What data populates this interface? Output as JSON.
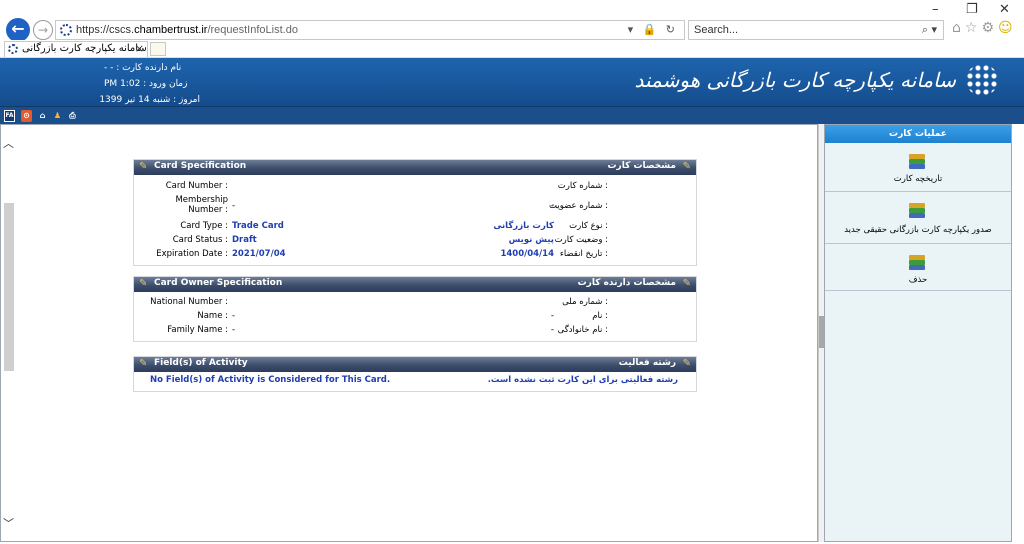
{
  "browser": {
    "url_prefix": "https://cscs.",
    "url_domain": "chambertrust.ir",
    "url_path": "/requestInfoList.do",
    "address_tools": "▾ 🔒 ↻",
    "search_placeholder": "Search...",
    "search_icon": "⌕ ▾",
    "toolbar_icons": [
      "home-icon",
      "star-icon",
      "gear-icon",
      "smiley-icon"
    ],
    "tab_title": "... سامانه یکپارچه کارت بازرگانی",
    "tab_close": "×"
  },
  "header": {
    "holder_name": "نام دارنده کارت : - -",
    "login_time": "زمان ورود : 1:02 PM",
    "today": "امروز : شنبه 14 تیر 1399",
    "logo_text": "سامانه یکپارچه کارت بازرگانی هوشمند",
    "toolbar": [
      "FA",
      "settings-icon",
      "home-icon",
      "user-icon",
      "print-icon"
    ],
    "fa_label": "FA"
  },
  "card_spec": {
    "title_en": "Card Specification",
    "title_fa": "مشخصات کارت",
    "rows": [
      {
        "label_en": "Card Number :",
        "value_en": "",
        "label_fa": ": شماره کارت",
        "value_fa": ""
      },
      {
        "label_en": "Membership Number :",
        "value_en": "-",
        "label_fa": ": شماره عضویت",
        "value_fa": "-"
      },
      {
        "label_en": "Card Type :",
        "value_en": "Trade Card",
        "label_fa": ": نوع کارت",
        "value_fa": "کارت بازرگانی"
      },
      {
        "label_en": "Card Status :",
        "value_en": "Draft",
        "label_fa": ": وضعیت کارت",
        "value_fa": "پیش نویس"
      },
      {
        "label_en": "Expiration Date :",
        "value_en": "2021/07/04",
        "label_fa": ": تاریخ انقضاء",
        "value_fa": "1400/04/14"
      }
    ]
  },
  "owner_spec": {
    "title_en": "Card Owner Specification",
    "title_fa": "مشخصات دارنده کارت",
    "rows": [
      {
        "label_en": "National Number :",
        "value_en": "",
        "label_fa": ": شماره ملی",
        "value_fa": ""
      },
      {
        "label_en": "Name :",
        "value_en": "-",
        "label_fa": ": نام",
        "value_fa": "-"
      },
      {
        "label_en": "Family Name :",
        "value_en": "-",
        "label_fa": ": نام خانوادگی",
        "value_fa": "-"
      }
    ]
  },
  "activity": {
    "title_en": "Field(s) of Activity",
    "title_fa": "رشته فعالیت",
    "message_en": "No Field(s) of Activity is Considered for This Card.",
    "message_fa": "رشته فعالیتی برای این کارت ثبت نشده است."
  },
  "sidebar": {
    "title": "عملیات کارت",
    "items": [
      {
        "label": "تاریخچه کارت",
        "icon": "books-icon"
      },
      {
        "label": "صدور یکپارچه کارت بازرگانی حقیقی جدید",
        "icon": "books-icon"
      },
      {
        "label": "حذف",
        "icon": "books-icon"
      }
    ]
  }
}
